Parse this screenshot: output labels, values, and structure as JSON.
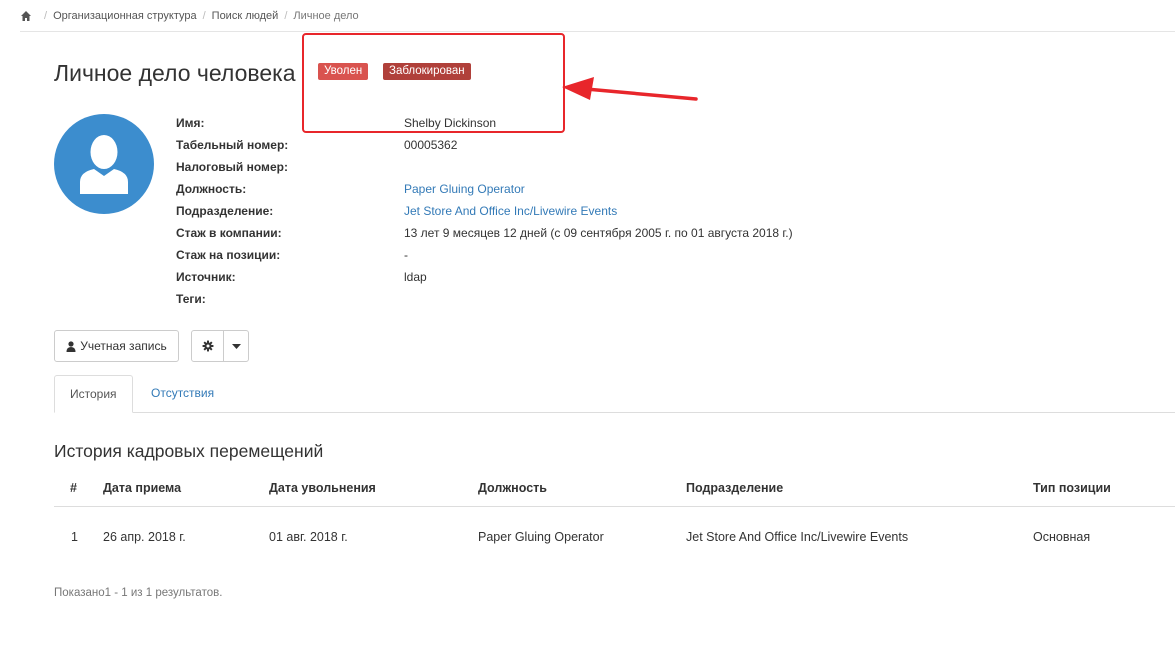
{
  "breadcrumb": {
    "items": [
      "Организационная структура",
      "Поиск людей"
    ],
    "current": "Личное дело"
  },
  "page": {
    "title": "Личное дело человека",
    "badges": {
      "fired": "Уволен",
      "blocked": "Заблокирован"
    }
  },
  "profile": {
    "labels": {
      "name": "Имя:",
      "tab_number": "Табельный номер:",
      "tax_number": "Налоговый номер:",
      "position": "Должность:",
      "department": "Подразделение:",
      "company_tenure": "Стаж в компании:",
      "position_tenure": "Стаж на позиции:",
      "source": "Источник:",
      "tags": "Теги:"
    },
    "values": {
      "name": "Shelby Dickinson",
      "tab_number": "00005362",
      "tax_number": "",
      "position": "Paper Gluing Operator",
      "department": "Jet Store And Office Inc/Livewire Events",
      "company_tenure": "13 лет 9 месяцев 12 дней (с 09 сентября 2005 г. по 01 августа 2018 г.)",
      "position_tenure": "-",
      "source": "ldap",
      "tags": ""
    }
  },
  "buttons": {
    "account": "Учетная запись"
  },
  "tabs": {
    "history": "История",
    "absences": "Отсутствия"
  },
  "history": {
    "title": "История кадровых перемещений",
    "columns": [
      "#",
      "Дата приема",
      "Дата увольнения",
      "Должность",
      "Подразделение",
      "Тип позиции"
    ],
    "rows": [
      [
        "1",
        "26 апр. 2018 г.",
        "01 авг. 2018 г.",
        "Paper Gluing Operator",
        "Jet Store And Office Inc/Livewire Events",
        "Основная"
      ]
    ],
    "summary": "Показано1 - 1 из 1 результатов."
  },
  "colors": {
    "danger": "#d9534f",
    "link": "#337ab7",
    "avatar": "#3c8dce",
    "annotation": "#e8262b"
  },
  "icons": [
    "home-icon",
    "user-icon",
    "gear-icon",
    "caret-down-icon",
    "annotation-arrow-icon"
  ]
}
